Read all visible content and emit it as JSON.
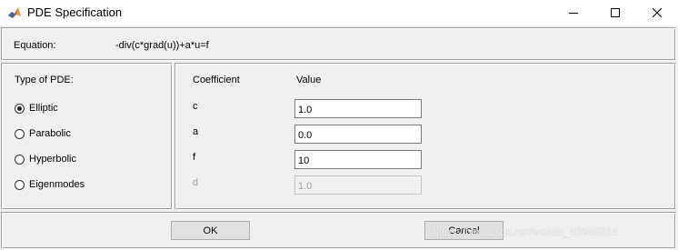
{
  "window": {
    "title": "PDE Specification",
    "icon": "matlab-icon"
  },
  "equation": {
    "label": "Equation:",
    "value": "-div(c*grad(u))+a*u=f"
  },
  "pde_type": {
    "heading": "Type of PDE:",
    "options": [
      {
        "label": "Elliptic",
        "selected": true
      },
      {
        "label": "Parabolic",
        "selected": false
      },
      {
        "label": "Hyperbolic",
        "selected": false
      },
      {
        "label": "Eigenmodes",
        "selected": false
      }
    ]
  },
  "coefficients": {
    "col_coefficient": "Coefficient",
    "col_value": "Value",
    "rows": [
      {
        "name": "c",
        "value": "1.0",
        "enabled": true
      },
      {
        "name": "a",
        "value": "0.0",
        "enabled": true
      },
      {
        "name": "f",
        "value": "10",
        "enabled": true
      },
      {
        "name": "d",
        "value": "1.0",
        "enabled": false
      }
    ]
  },
  "buttons": {
    "ok": "OK",
    "cancel": "Cancel"
  },
  "watermark": "https://blog.csdn.net/weixin_43940314"
}
